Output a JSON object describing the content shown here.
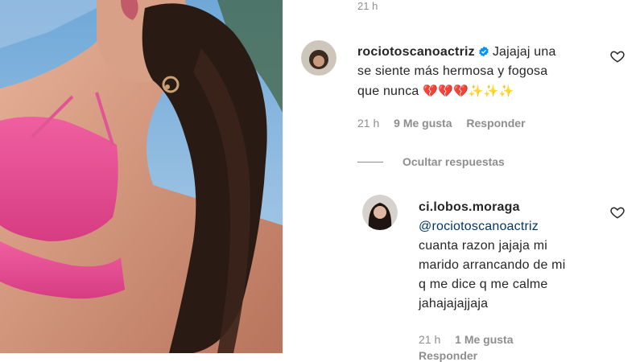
{
  "post": {
    "photo_alt": "Selfie photo of a woman in a pink bikini"
  },
  "comments": {
    "prev_time": "21 h",
    "main": {
      "username": "rociotoscanoactriz",
      "verified": true,
      "text": "Jajajaj una se siente más hermosa y fogosa que nunca",
      "text_line1": "Jajajaj una",
      "text_line2": "se siente más hermosa y fogosa",
      "text_line3": "que nunca",
      "emojis": "💔💔💔✨✨✨",
      "time": "21 h",
      "likes": "9 Me gusta",
      "reply_label": "Responder"
    },
    "hide_replies_label": "Ocultar respuestas",
    "reply": {
      "username": "ci.lobos.moraga",
      "mention": "@rociotoscanoactriz",
      "text_line1": "cuanta razon jajaja mi",
      "text_line2": "marido arrancando de mi",
      "text_line3": "q me dice q me calme",
      "text_line4": "jahajajajjaja",
      "time": "21 h",
      "likes": "1 Me gusta",
      "reply_label": "Responder"
    }
  },
  "colors": {
    "text": "#262626",
    "secondary": "#8e8e8e",
    "mention": "#00376b",
    "verified": "#0095f6"
  },
  "icons": [
    "heart-icon",
    "verified-badge-icon"
  ]
}
